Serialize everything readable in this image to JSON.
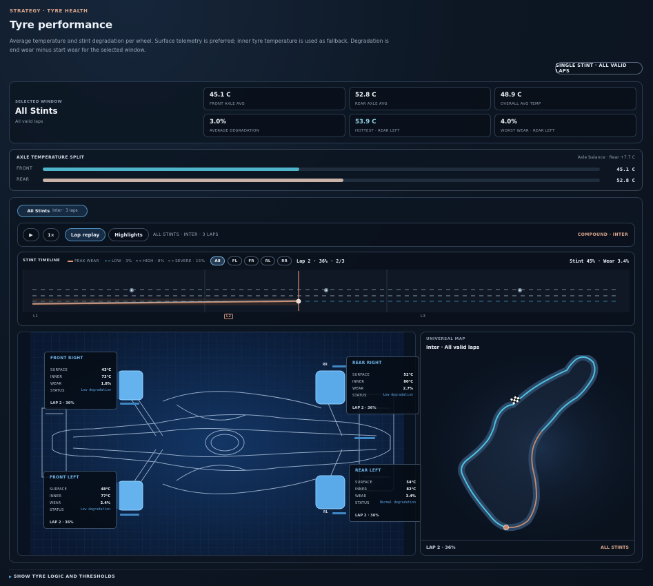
{
  "header": {
    "eyebrow": "STRATEGY · TYRE HEALTH",
    "title": "Tyre performance",
    "description": "Average temperature and stint degradation per wheel. Surface telemetry is preferred; inner tyre temperature is used as fallback. Degradation is end wear minus start wear for the selected window.",
    "mode_button": "SINGLE STINT · ALL VALID LAPS"
  },
  "summary": {
    "selected_window_label": "SELECTED WINDOW",
    "selected_window_value": "All Stints",
    "selected_window_sub": "All valid laps",
    "stats": [
      {
        "value": "45.1 C",
        "label": "FRONT AXLE AVG"
      },
      {
        "value": "52.8 C",
        "label": "REAR AXLE AVG"
      },
      {
        "value": "48.9 C",
        "label": "OVERALL AVG TEMP"
      },
      {
        "value": "3.0%",
        "label": "AVERAGE DEGRADATION"
      },
      {
        "value": "53.9 C",
        "label": "HOTTEST · REAR LEFT"
      },
      {
        "value": "4.0%",
        "label": "WORST WEAR · REAR LEFT"
      }
    ]
  },
  "axle_split": {
    "title": "AXLE TEMPERATURE SPLIT",
    "balance": "Axle balance · Rear +7.7 C",
    "front": {
      "label": "FRONT",
      "value": "45.1 C",
      "fraction": 0.46,
      "color": "#4fb3c9"
    },
    "rear": {
      "label": "REAR",
      "value": "52.8 C",
      "fraction": 0.54,
      "color": "#c9b3a8"
    }
  },
  "stint_chip": {
    "name": "All Stints",
    "detail": "Inter · 3 laps"
  },
  "controls": {
    "play_icon": "play-icon",
    "speed": "1×",
    "lap_replay": "Lap replay",
    "highlights": "Highlights",
    "info": "ALL STINTS · INTER · 3 LAPS",
    "compound": "COMPOUND · INTER"
  },
  "timeline": {
    "title": "STINT TIMELINE",
    "legend": [
      "PEAK WEAR",
      "LOW · 3%",
      "HIGH · 8%",
      "SEVERE · 15%"
    ],
    "filters": [
      "All",
      "FL",
      "FR",
      "RL",
      "RR"
    ],
    "active_filter": "All",
    "lap_readout": "Lap 2 · 36% · 2/3",
    "stint_readout": "Stint 45% · Wear 3.4%",
    "lap_labels": [
      "L1",
      "L2",
      "L3"
    ],
    "current_lap": "L2",
    "playhead_fraction": 0.466
  },
  "wheels": {
    "front_right": {
      "title": "FRONT RIGHT",
      "surface": "43°C",
      "inner": "73°C",
      "wear": "1.8%",
      "status": "Low degradation",
      "lap": "LAP 2 · 36%"
    },
    "rear_right": {
      "title": "REAR RIGHT",
      "surface": "52°C",
      "inner": "80°C",
      "wear": "2.7%",
      "status": "Low degradation",
      "lap": "LAP 2 · 36%",
      "tag": "RR"
    },
    "front_left": {
      "title": "FRONT LEFT",
      "surface": "48°C",
      "inner": "77°C",
      "wear": "2.4%",
      "status": "Low degradation",
      "lap": "LAP 2 · 36%"
    },
    "rear_left": {
      "title": "REAR LEFT",
      "surface": "54°C",
      "inner": "82°C",
      "wear": "3.4%",
      "status": "Normal degradation",
      "lap": "LAP 2 · 36%",
      "tag": "RL"
    },
    "row_labels": {
      "surface": "SURFACE",
      "inner": "INNER",
      "wear": "WEAR",
      "status": "STATUS"
    }
  },
  "map": {
    "eyebrow": "UNIVERSAL MAP",
    "title": "Inter · All valid laps",
    "lap": "LAP 2 · 36%",
    "stints": "ALL STINTS",
    "finish_icon": "checkered-flag-icon"
  },
  "footer": {
    "toggle": "SHOW TYRE LOGIC AND THRESHOLDS"
  }
}
